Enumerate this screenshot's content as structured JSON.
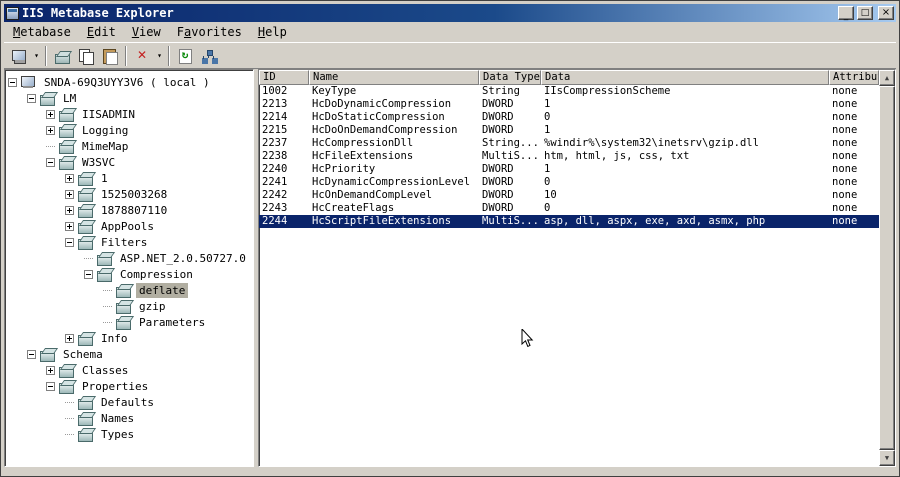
{
  "window": {
    "title": "IIS Metabase Explorer",
    "controls": {
      "minimize": "_",
      "maximize": "□",
      "close": "×"
    }
  },
  "menu": {
    "items": [
      {
        "label": "Metabase",
        "underline_index": 0
      },
      {
        "label": "Edit",
        "underline_index": 0
      },
      {
        "label": "View",
        "underline_index": 0
      },
      {
        "label": "Favorites",
        "underline_index": 1
      },
      {
        "label": "Help",
        "underline_index": 0
      }
    ]
  },
  "toolbar": {
    "buttons": [
      {
        "type": "button",
        "name": "connect",
        "icon": "computer-icon",
        "dropdown": true
      },
      {
        "type": "separator"
      },
      {
        "type": "button",
        "name": "new-key",
        "icon": "new-key-icon"
      },
      {
        "type": "button",
        "name": "copy",
        "icon": "copy-icon"
      },
      {
        "type": "button",
        "name": "paste",
        "icon": "paste-icon"
      },
      {
        "type": "separator"
      },
      {
        "type": "button",
        "name": "delete",
        "icon": "delete-icon",
        "dropdown": true
      },
      {
        "type": "separator"
      },
      {
        "type": "button",
        "name": "refresh",
        "icon": "refresh-icon"
      },
      {
        "type": "button",
        "name": "view-tree",
        "icon": "network-icon"
      }
    ]
  },
  "tree": {
    "items": [
      {
        "label": "SNDA-69Q3UYY3V6 ( local )",
        "depth": 0,
        "expander": "minus",
        "icon": "computer",
        "selected": false
      },
      {
        "label": "LM",
        "depth": 1,
        "expander": "minus",
        "icon": "key",
        "selected": false
      },
      {
        "label": "IISADMIN",
        "depth": 2,
        "expander": "plus",
        "icon": "key",
        "selected": false
      },
      {
        "label": "Logging",
        "depth": 2,
        "expander": "plus",
        "icon": "key",
        "selected": false
      },
      {
        "label": "MimeMap",
        "depth": 2,
        "expander": "none",
        "icon": "key",
        "selected": false
      },
      {
        "label": "W3SVC",
        "depth": 2,
        "expander": "minus",
        "icon": "key",
        "selected": false
      },
      {
        "label": "1",
        "depth": 3,
        "expander": "plus",
        "icon": "key",
        "selected": false
      },
      {
        "label": "1525003268",
        "depth": 3,
        "expander": "plus",
        "icon": "key",
        "selected": false
      },
      {
        "label": "1878807110",
        "depth": 3,
        "expander": "plus",
        "icon": "key",
        "selected": false
      },
      {
        "label": "AppPools",
        "depth": 3,
        "expander": "plus",
        "icon": "key",
        "selected": false
      },
      {
        "label": "Filters",
        "depth": 3,
        "expander": "minus",
        "icon": "key",
        "selected": false
      },
      {
        "label": "ASP.NET_2.0.50727.0",
        "depth": 4,
        "expander": "none",
        "icon": "key",
        "selected": false
      },
      {
        "label": "Compression",
        "depth": 4,
        "expander": "minus",
        "icon": "key",
        "selected": false
      },
      {
        "label": "deflate",
        "depth": 5,
        "expander": "none",
        "icon": "key",
        "selected": true
      },
      {
        "label": "gzip",
        "depth": 5,
        "expander": "none",
        "icon": "key",
        "selected": false
      },
      {
        "label": "Parameters",
        "depth": 5,
        "expander": "none",
        "icon": "key",
        "selected": false
      },
      {
        "label": "Info",
        "depth": 3,
        "expander": "plus",
        "icon": "key",
        "selected": false
      },
      {
        "label": "Schema",
        "depth": 1,
        "expander": "minus",
        "icon": "key",
        "selected": false
      },
      {
        "label": "Classes",
        "depth": 2,
        "expander": "plus",
        "icon": "key",
        "selected": false
      },
      {
        "label": "Properties",
        "depth": 2,
        "expander": "minus",
        "icon": "key",
        "selected": false
      },
      {
        "label": "Defaults",
        "depth": 3,
        "expander": "none",
        "icon": "key",
        "selected": false
      },
      {
        "label": "Names",
        "depth": 3,
        "expander": "none",
        "icon": "key",
        "selected": false
      },
      {
        "label": "Types",
        "depth": 3,
        "expander": "none",
        "icon": "key",
        "selected": false
      }
    ]
  },
  "list": {
    "columns": [
      "ID",
      "Name",
      "Data Type",
      "Data",
      "Attributes"
    ],
    "rows": [
      {
        "cells": [
          "1002",
          "KeyType",
          "String",
          "IIsCompressionScheme",
          "none"
        ],
        "selected": false
      },
      {
        "cells": [
          "2213",
          "HcDoDynamicCompression",
          "DWORD",
          "1",
          "none"
        ],
        "selected": false
      },
      {
        "cells": [
          "2214",
          "HcDoStaticCompression",
          "DWORD",
          "0",
          "none"
        ],
        "selected": false
      },
      {
        "cells": [
          "2215",
          "HcDoOnDemandCompression",
          "DWORD",
          "1",
          "none"
        ],
        "selected": false
      },
      {
        "cells": [
          "2237",
          "HcCompressionDll",
          "String...",
          "%windir%\\system32\\inetsrv\\gzip.dll",
          "none"
        ],
        "selected": false
      },
      {
        "cells": [
          "2238",
          "HcFileExtensions",
          "MultiS...",
          "htm, html, js, css, txt",
          "none"
        ],
        "selected": false
      },
      {
        "cells": [
          "2240",
          "HcPriority",
          "DWORD",
          "1",
          "none"
        ],
        "selected": false
      },
      {
        "cells": [
          "2241",
          "HcDynamicCompressionLevel",
          "DWORD",
          "0",
          "none"
        ],
        "selected": false
      },
      {
        "cells": [
          "2242",
          "HcOnDemandCompLevel",
          "DWORD",
          "10",
          "none"
        ],
        "selected": false
      },
      {
        "cells": [
          "2243",
          "HcCreateFlags",
          "DWORD",
          "0",
          "none"
        ],
        "selected": false
      },
      {
        "cells": [
          "2244",
          "HcScriptFileExtensions",
          "MultiS...",
          "asp, dll, aspx, exe, axd, asmx, php",
          "none"
        ],
        "selected": true
      }
    ]
  },
  "scrollbar": {
    "up_arrow": "▲",
    "down_arrow": "▼"
  },
  "colors": {
    "chrome": "#d4d0c8",
    "titlebar_start": "#0a246a",
    "titlebar_end": "#a6caf0",
    "selection": "#0a246a",
    "inactive_selection": "#b1aea1",
    "delete_icon": "#c42020",
    "refresh_icon": "#0a8a0a"
  }
}
